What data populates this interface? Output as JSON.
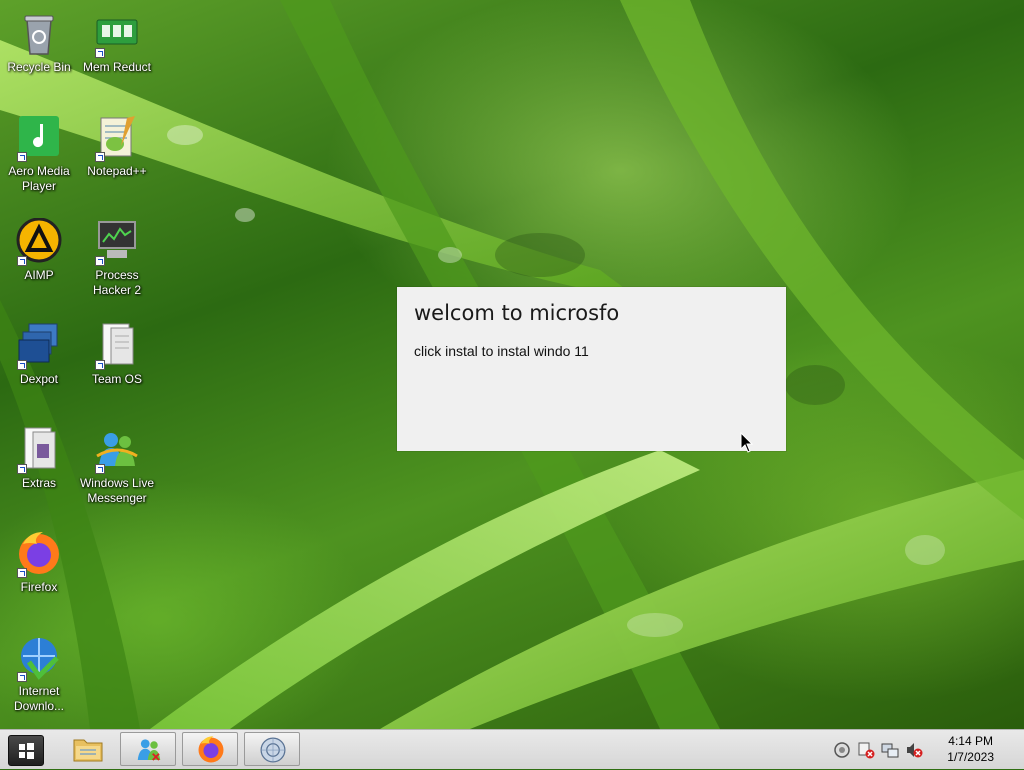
{
  "desktop": {
    "icons": [
      {
        "label": "Recycle Bin",
        "icon": "recycle-bin-icon",
        "shortcut": false
      },
      {
        "label": "Mem Reduct",
        "icon": "memory-chip-icon",
        "shortcut": true
      },
      {
        "label": "Aero Media Player",
        "icon": "music-note-icon",
        "shortcut": true
      },
      {
        "label": "Notepad++",
        "icon": "notepad-plus-icon",
        "shortcut": true
      },
      {
        "label": "AIMP",
        "icon": "aimp-triangle-icon",
        "shortcut": true
      },
      {
        "label": "Process Hacker 2",
        "icon": "monitor-chart-icon",
        "shortcut": true
      },
      {
        "label": "Dexpot",
        "icon": "virtual-desktops-icon",
        "shortcut": true
      },
      {
        "label": "Team OS",
        "icon": "folder-doc-icon",
        "shortcut": true
      },
      {
        "label": "Extras",
        "icon": "folder-doc-icon",
        "shortcut": true
      },
      {
        "label": "Windows Live Messenger",
        "icon": "messenger-people-icon",
        "shortcut": true
      },
      {
        "label": "Firefox",
        "icon": "firefox-icon",
        "shortcut": true
      },
      {
        "label": "Internet Downlo...",
        "icon": "download-globe-icon",
        "shortcut": true
      }
    ]
  },
  "dialog": {
    "title": "welcom to microsfo",
    "message": "click instal to instal windo 11"
  },
  "taskbar": {
    "pinned": [
      {
        "name": "file-explorer",
        "icon": "folder-icon"
      },
      {
        "name": "messenger",
        "icon": "messenger-people-icon"
      },
      {
        "name": "firefox",
        "icon": "firefox-icon"
      },
      {
        "name": "disk-app",
        "icon": "disk-globe-icon"
      }
    ],
    "tray_icons": [
      "circle-icon",
      "network-warning-icon",
      "monitor-network-icon",
      "volume-muted-icon"
    ],
    "clock": {
      "time": "4:14 PM",
      "date": "1/7/2023"
    }
  }
}
